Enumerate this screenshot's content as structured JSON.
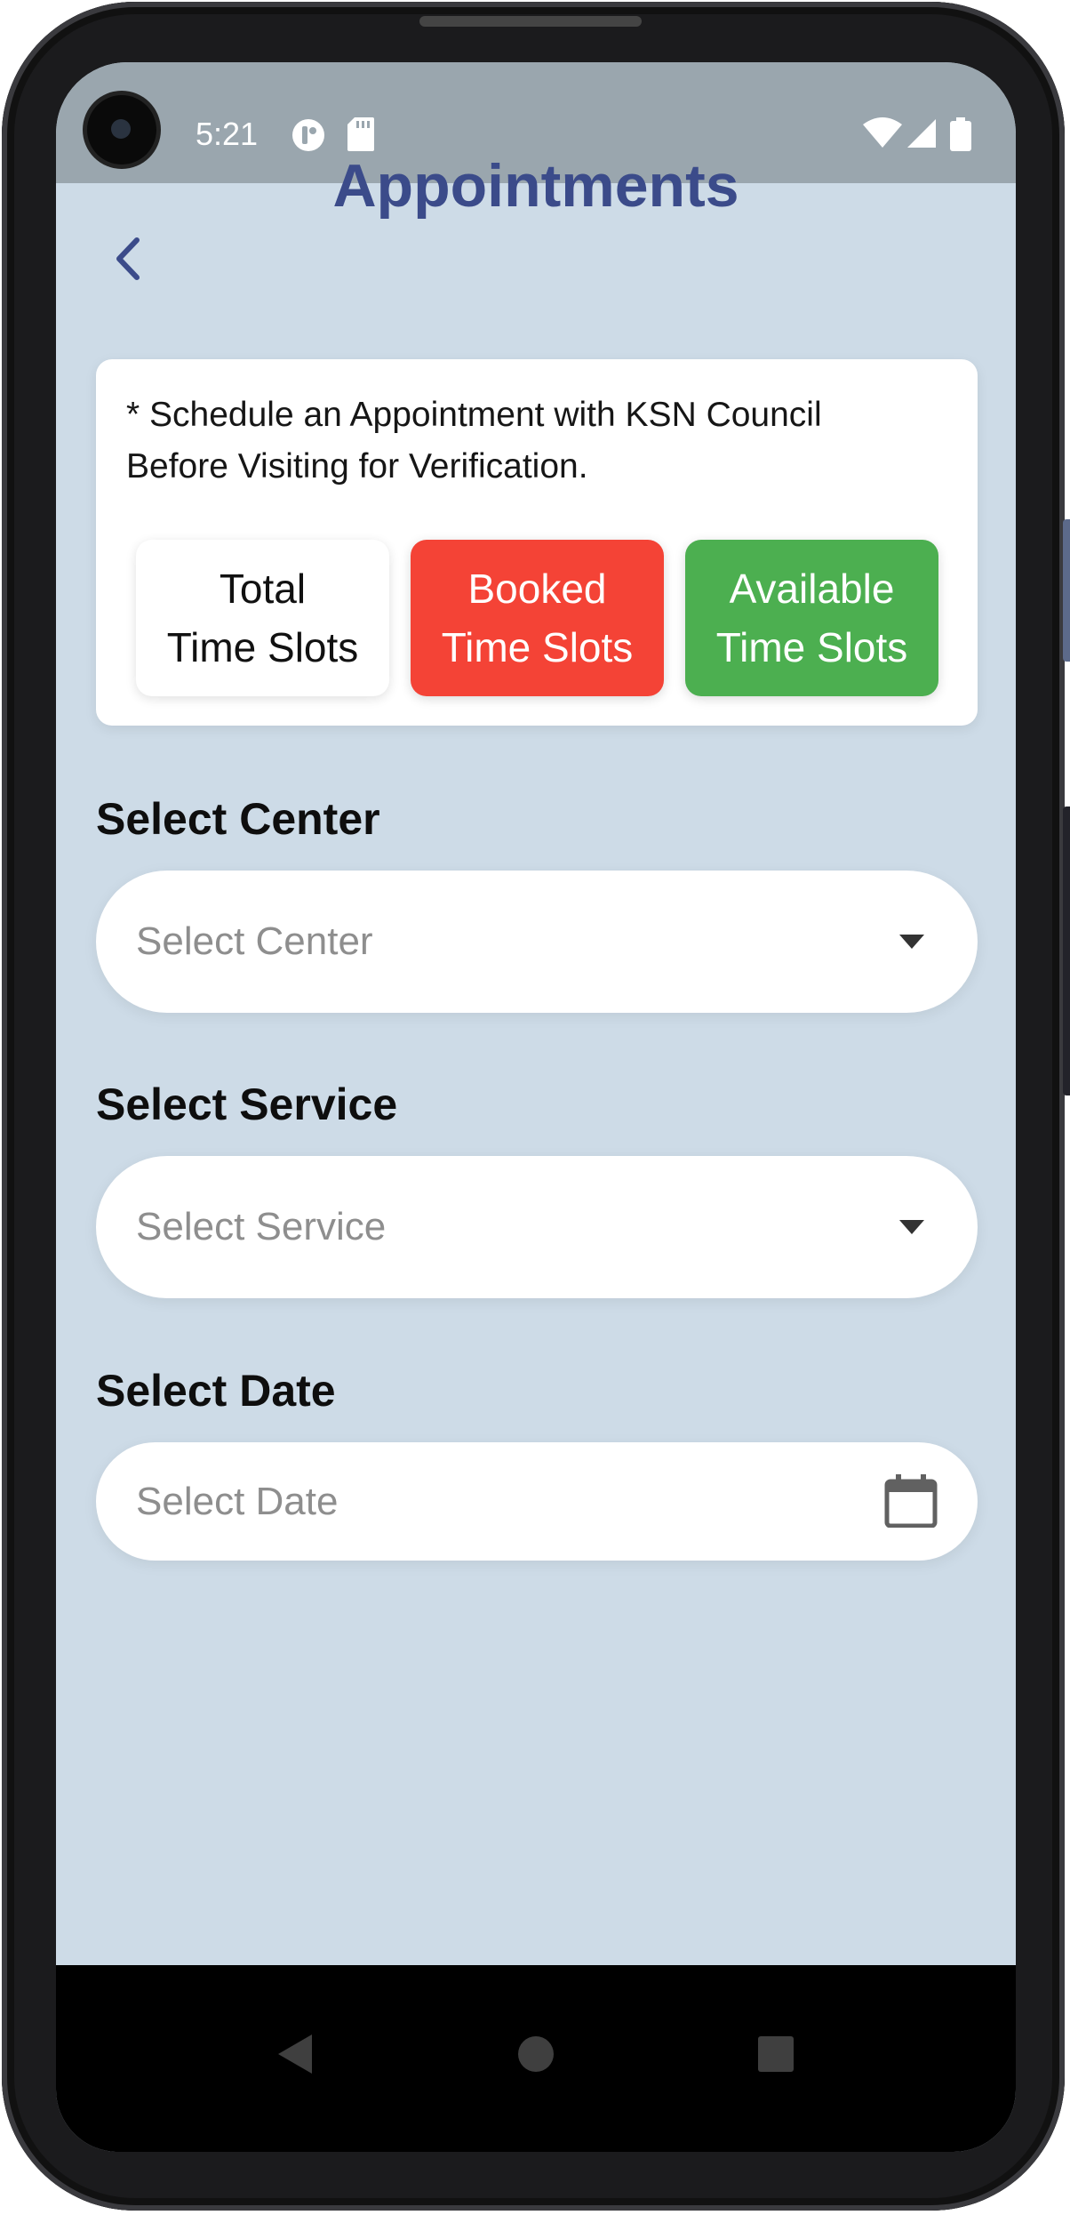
{
  "status_bar": {
    "time": "5:21",
    "left_icons": [
      "app-notification-icon",
      "sd-card-icon"
    ],
    "right_icons": [
      "wifi-icon",
      "signal-icon",
      "battery-icon"
    ]
  },
  "header": {
    "title": "Appointments",
    "back_icon": "chevron-left-icon",
    "title_color": "#3b4b8a"
  },
  "info_card": {
    "notice": "* Schedule an Appointment with KSN Council Before Visiting for Verification.",
    "legend": {
      "total": {
        "line1": "Total",
        "line2": "Time Slots",
        "color": "#ffffff"
      },
      "booked": {
        "line1": "Booked",
        "line2": "Time Slots",
        "color": "#f44336"
      },
      "available": {
        "line1": "Available",
        "line2": "Time Slots",
        "color": "#4caf50"
      }
    }
  },
  "form": {
    "center": {
      "label": "Select Center",
      "placeholder": "Select Center",
      "icon": "dropdown-arrow-icon"
    },
    "service": {
      "label": "Select Service",
      "placeholder": "Select Service",
      "icon": "dropdown-arrow-icon"
    },
    "date": {
      "label": "Select Date",
      "placeholder": "Select Date",
      "icon": "calendar-icon"
    }
  },
  "nav_bar": {
    "buttons": [
      "back-triangle-icon",
      "home-circle-icon",
      "recents-square-icon"
    ]
  },
  "colors": {
    "screen_bg": "#cddbe7",
    "status_bar_bg": "#9aa6ae",
    "accent": "#3b4b8a"
  }
}
